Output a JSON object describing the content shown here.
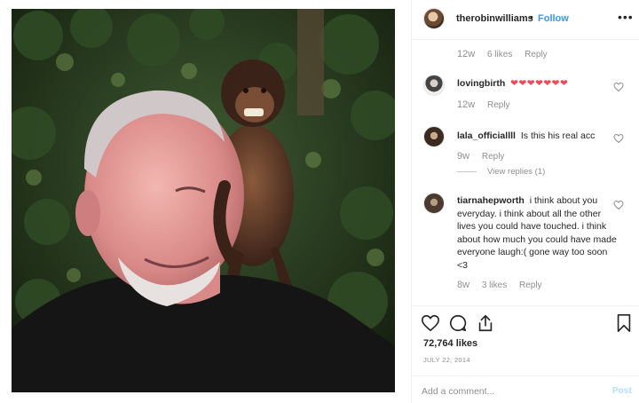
{
  "post": {
    "image_icon": "photo-robin-williams-with-capuchin-monkey"
  },
  "header": {
    "username": "therobinwilliams",
    "dot": "•",
    "follow_label": "Follow",
    "more_icon": "ellipsis-icon"
  },
  "comments": [
    {
      "username": "",
      "text": "",
      "age": "12w",
      "likes": "6 likes",
      "reply": "Reply"
    },
    {
      "username": "lovingbirth",
      "text": "❤❤❤❤❤❤❤",
      "age": "12w",
      "likes": "",
      "reply": "Reply"
    },
    {
      "username": "lala_officiallll",
      "text": "Is this his real acc",
      "age": "9w",
      "likes": "",
      "reply": "Reply",
      "view_replies": "View replies (1)"
    },
    {
      "username": "tiarnahepworth",
      "text": "i think about you everyday. i think about all the other lives you could have touched. i think about how much you could have made everyone laugh:( gone way too soon <3",
      "age": "8w",
      "likes": "3 likes",
      "reply": "Reply"
    }
  ],
  "actions": {
    "like_icon": "heart-icon",
    "comment_icon": "comment-icon",
    "share_icon": "share-icon",
    "save_icon": "bookmark-icon",
    "likes_count": "72,764 likes",
    "date": "JULY 22, 2014"
  },
  "composer": {
    "placeholder": "Add a comment...",
    "post_label": "Post"
  },
  "colors": {
    "link_blue": "#3897f0",
    "muted": "#8e8e8e",
    "heart_red": "#ed4956"
  }
}
